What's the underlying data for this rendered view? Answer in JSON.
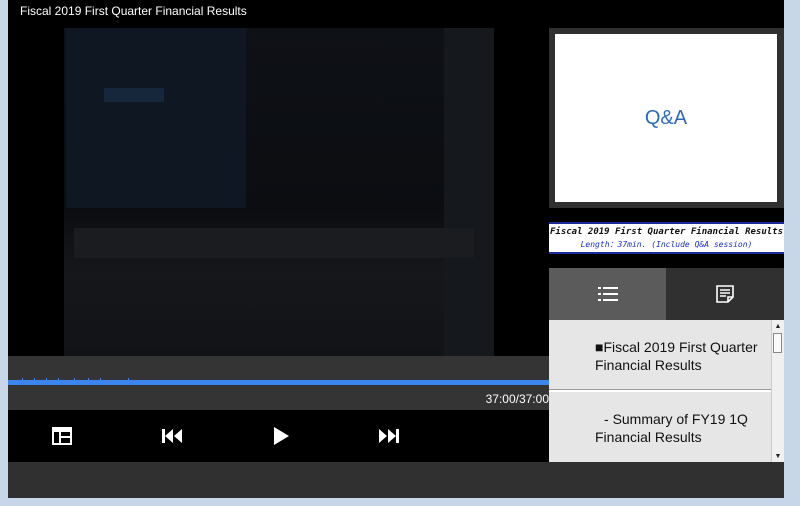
{
  "window": {
    "title": "Fiscal 2019 First Quarter  Financial Results"
  },
  "player": {
    "time_display": "37:00/37:00",
    "progress_fraction": 1.0
  },
  "slide": {
    "text": "Q&A"
  },
  "banner": {
    "title": "Fiscal 2019 First Quarter Financial Results",
    "subtitle": "Length：37min. (Include Q&A session)"
  },
  "controls": {
    "layout": "layout-icon",
    "previous": "skip-previous-icon",
    "play": "play-icon",
    "next": "skip-next-icon"
  },
  "tabs": {
    "list": "list-icon",
    "notes": "notes-icon"
  },
  "chapters": [
    {
      "bullet": "■",
      "label": "Fiscal 2019 First Quarter Financial Results"
    },
    {
      "bullet": "-",
      "label": "Summary of FY19 1Q Financial Results"
    }
  ],
  "colors": {
    "accent": "#3b86ee",
    "slide_text": "#2e6bb5",
    "banner_border": "#1a2a9a"
  }
}
